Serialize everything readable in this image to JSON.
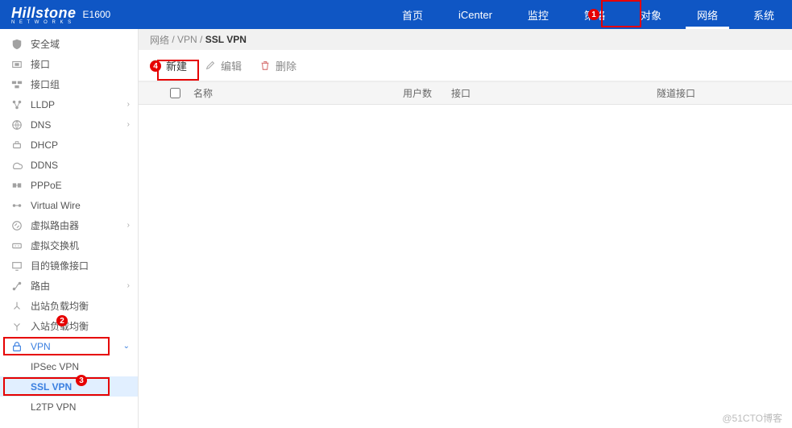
{
  "header": {
    "logo": "Hillstone",
    "logo_sub": "N E T W O R K S",
    "model": "E1600",
    "nav": [
      "首页",
      "iCenter",
      "监控",
      "策略",
      "对象",
      "网络",
      "系统"
    ],
    "active_nav": "网络"
  },
  "sidebar": {
    "items": [
      {
        "label": "安全域",
        "icon": "shield"
      },
      {
        "label": "接口",
        "icon": "port"
      },
      {
        "label": "接口组",
        "icon": "port-group"
      },
      {
        "label": "LLDP",
        "icon": "lldp",
        "expandable": true
      },
      {
        "label": "DNS",
        "icon": "dns",
        "expandable": true
      },
      {
        "label": "DHCP",
        "icon": "dhcp"
      },
      {
        "label": "DDNS",
        "icon": "ddns"
      },
      {
        "label": "PPPoE",
        "icon": "pppoe"
      },
      {
        "label": "Virtual Wire",
        "icon": "vwire"
      },
      {
        "label": "虚拟路由器",
        "icon": "vrouter",
        "expandable": true
      },
      {
        "label": "虚拟交换机",
        "icon": "vswitch"
      },
      {
        "label": "目的镜像接口",
        "icon": "mirror"
      },
      {
        "label": "路由",
        "icon": "route",
        "expandable": true
      },
      {
        "label": "出站负载均衡",
        "icon": "lb-out"
      },
      {
        "label": "入站负载均衡",
        "icon": "lb-in"
      },
      {
        "label": "VPN",
        "icon": "vpn",
        "expandable": true,
        "expanded": true,
        "children": [
          {
            "label": "IPSec VPN"
          },
          {
            "label": "SSL VPN",
            "active": true
          },
          {
            "label": "L2TP VPN"
          }
        ]
      }
    ]
  },
  "breadcrumb": {
    "segments": [
      "网络",
      "VPN"
    ],
    "current": "SSL VPN"
  },
  "toolbar": {
    "new": "新建",
    "edit": "编辑",
    "delete": "删除"
  },
  "table": {
    "columns": {
      "name": "名称",
      "users": "用户数",
      "interface": "接口",
      "tunnel": "隧道接口"
    }
  },
  "annotations": {
    "b1": "1",
    "b2": "2",
    "b3": "3",
    "b4": "4"
  },
  "watermark": "@51CTO博客"
}
